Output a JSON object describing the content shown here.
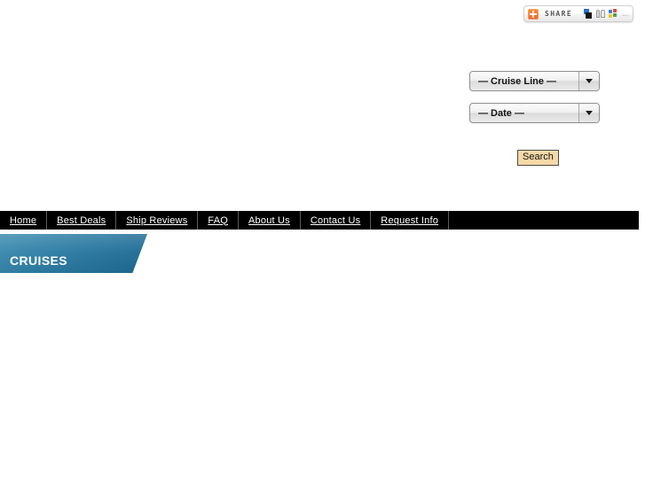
{
  "share": {
    "plus_icon": "plus-icon",
    "label": "SHARE",
    "icons": [
      "bookmark-icon",
      "friends-icon",
      "more-services-icon"
    ],
    "ellipsis": "..."
  },
  "search_form": {
    "cruise_line": {
      "selected": "— Cruise Line —",
      "arrow_icon": "chevron-down-icon"
    },
    "date": {
      "selected": "— Date —",
      "arrow_icon": "chevron-down-icon"
    },
    "submit_label": "Search"
  },
  "nav": {
    "items": [
      {
        "label": "Home"
      },
      {
        "label": "Best Deals"
      },
      {
        "label": "Ship Reviews"
      },
      {
        "label": "FAQ"
      },
      {
        "label": "About Us"
      },
      {
        "label": "Contact Us"
      },
      {
        "label": "Request Info"
      }
    ]
  },
  "banner": {
    "title": "CRUISES"
  },
  "colors": {
    "nav_background": "#000000",
    "banner_blue_light": "#3d8cb0",
    "banner_blue_dark": "#1e6a92",
    "search_button_bg": "#f6d9a6",
    "share_accent": "#f26522",
    "page_background": "#ffffff"
  }
}
